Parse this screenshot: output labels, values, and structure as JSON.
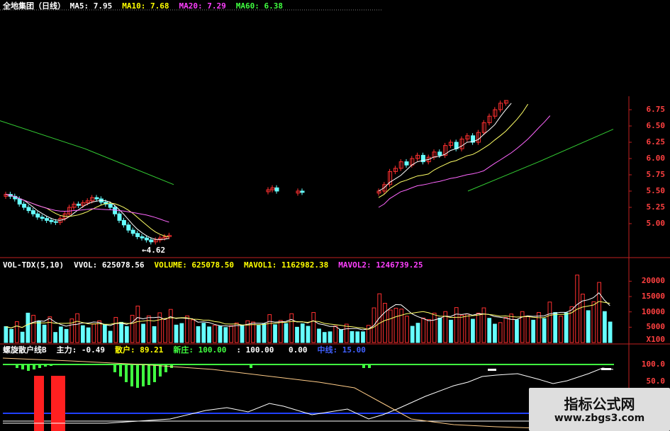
{
  "chart_data": [
    {
      "type": "candlestick",
      "title": "全地集团（日线）",
      "legend": [
        {
          "label": "MA5:",
          "value": "7.95",
          "color": "#ffffff"
        },
        {
          "label": "MA10:",
          "value": "7.68",
          "color": "#ffff00"
        },
        {
          "label": "MA20:",
          "value": "7.29",
          "color": "#ff40ff"
        },
        {
          "label": "MA60:",
          "value": "6.38",
          "color": "#40ff40"
        }
      ],
      "y_ticks": [
        "6.75",
        "6.50",
        "6.25",
        "6.00",
        "5.75",
        "5.50",
        "5.25",
        "5.00"
      ],
      "ylim": [
        4.7,
        6.9
      ],
      "annotation": "←4.62",
      "colors": {
        "up": "#ff3030",
        "down": "#66ffff",
        "ma5": "#ffffff",
        "ma10": "#ffff66",
        "ma20": "#ff66ff",
        "ma60": "#33cc33"
      }
    },
    {
      "type": "bar",
      "legend": [
        {
          "label": "VOL-TDX(5,10)",
          "value": "",
          "color": "#ffffff"
        },
        {
          "label": "VVOL:",
          "value": "625078.56",
          "color": "#ffffff"
        },
        {
          "label": "VOLUME:",
          "value": "625078.50",
          "color": "#ffff00"
        },
        {
          "label": "MAVOL1:",
          "value": "1162982.38",
          "color": "#ffff00"
        },
        {
          "label": "MAVOL2:",
          "value": "1246739.25",
          "color": "#ff40ff"
        }
      ],
      "y_ticks": [
        "20000",
        "15000",
        "10000",
        "5000"
      ],
      "y_unit": "X100",
      "ylim": [
        0,
        24000
      ],
      "values": [
        5200,
        4300,
        6800,
        3400,
        9600,
        8900,
        7000,
        5700,
        8400,
        3300,
        5100,
        4300,
        7700,
        9400,
        5500,
        4800,
        6100,
        7100,
        5900,
        3700,
        8200,
        6600,
        5200,
        8900,
        11900,
        6000,
        8700,
        5200,
        9700,
        7800,
        10800,
        5700,
        6200,
        8700,
        7400,
        5200,
        6300,
        5100,
        5600,
        5300,
        4900,
        5500,
        6400,
        5700,
        7100,
        6700,
        5600,
        6100,
        9100,
        5800,
        7200,
        6200,
        9400,
        5000,
        6100,
        5300,
        9800,
        4400,
        3300,
        3500,
        5400,
        4200,
        6000,
        3600,
        3500,
        3500,
        5600,
        11300,
        15900,
        12800,
        10600,
        11200,
        10900,
        8600,
        5300,
        6300,
        8000,
        7500,
        9600,
        8000,
        10100,
        7300,
        11400,
        8900,
        9300,
        7600,
        9600,
        11300,
        7900,
        6000,
        6500,
        8200,
        9300,
        7400,
        10100,
        8600,
        7300,
        9800,
        7800,
        13200,
        9800,
        8600,
        9700,
        11700,
        22000,
        15800,
        10400,
        13300,
        19600,
        10100,
        6700
      ],
      "up_flags": [
        0,
        0,
        1,
        0,
        0,
        1,
        0,
        0,
        1,
        0,
        0,
        0,
        1,
        1,
        0,
        0,
        1,
        1,
        0,
        0,
        1,
        0,
        0,
        1,
        1,
        0,
        1,
        0,
        1,
        1,
        1,
        0,
        0,
        1,
        1,
        0,
        0,
        0,
        1,
        0,
        0,
        1,
        1,
        0,
        1,
        1,
        0,
        0,
        1,
        0,
        1,
        0,
        1,
        0,
        0,
        0,
        1,
        0,
        0,
        0,
        1,
        0,
        1,
        0,
        0,
        0,
        1,
        1,
        1,
        1,
        1,
        1,
        1,
        1,
        0,
        0,
        1,
        1,
        1,
        0,
        1,
        0,
        1,
        1,
        1,
        0,
        1,
        1,
        0,
        0,
        1,
        1,
        1,
        0,
        1,
        1,
        0,
        1,
        0,
        1,
        0,
        1,
        0,
        1,
        1,
        1,
        0,
        1,
        1,
        0,
        0
      ],
      "colors": {
        "up": "#ff3030",
        "down": "#66ffff",
        "ma1": "#ffffff",
        "ma2": "#ffff66"
      }
    },
    {
      "type": "line",
      "legend": [
        {
          "label": "螺旋散户线B",
          "value": "",
          "color": "#ffffff"
        },
        {
          "label": "主力:",
          "value": "-0.49",
          "color": "#ffffff"
        },
        {
          "label": "散户:",
          "value": "89.21",
          "color": "#ffff00"
        },
        {
          "label": "新庄:",
          "value": "100.00",
          "color": "#40ff40"
        },
        {
          "label": ":",
          "value": "100.00",
          "color": "#ffffff"
        },
        {
          "label": "",
          "value": "0.00",
          "color": "#ffffff"
        },
        {
          "label": "中线:",
          "value": "15.00",
          "color": "#4060ff"
        }
      ],
      "y_ticks": [
        "100.0",
        "50.0"
      ],
      "ylim": [
        -20,
        110
      ],
      "colors": {
        "green_bars": "#40ff40",
        "red_bars": "#ff2020",
        "retail": "#ffffff",
        "zhuli": "#ffcc88",
        "line100": "#40ff40",
        "line15": "#2040ff"
      }
    }
  ],
  "watermark": {
    "title": "指标公式网",
    "url": "www.zbgs3.com"
  }
}
